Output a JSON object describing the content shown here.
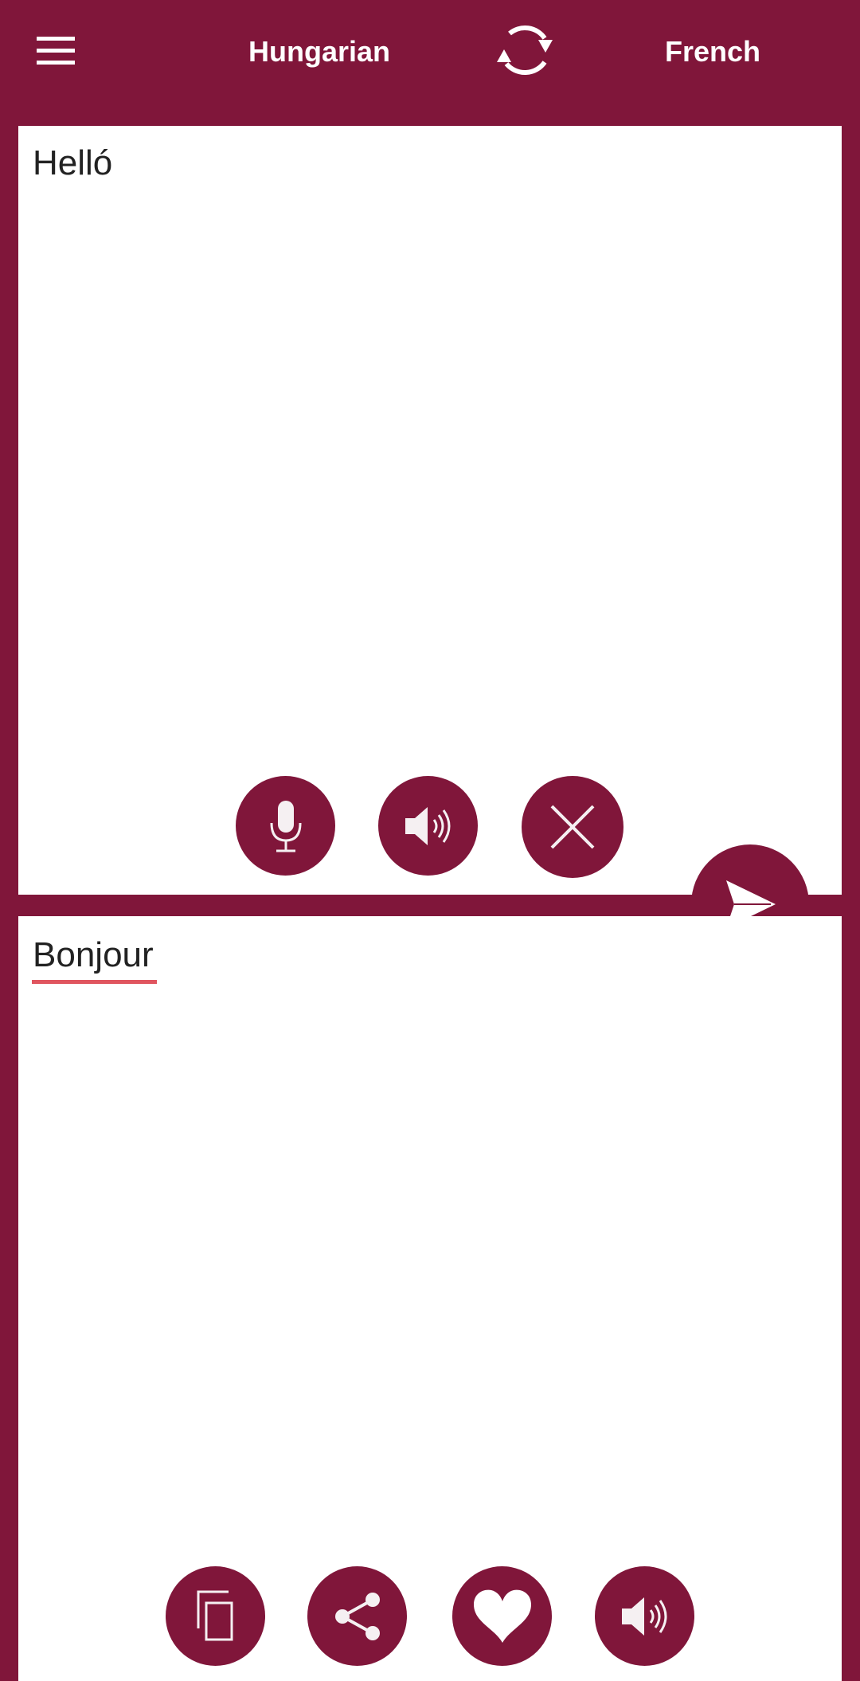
{
  "colors": {
    "brand": "#80163a",
    "panel": "#ffffff",
    "text": "#222222",
    "spellcheck_underline": "#e0555f"
  },
  "header": {
    "menu_icon": "hamburger-menu-icon",
    "source_language": "Hungarian",
    "swap_icon": "swap-languages-icon",
    "target_language": "French"
  },
  "input": {
    "text": "Helló",
    "actions": [
      {
        "name": "microphone",
        "icon": "microphone-icon"
      },
      {
        "name": "speak",
        "icon": "speaker-icon"
      },
      {
        "name": "clear",
        "icon": "close-icon"
      }
    ]
  },
  "translate_button": {
    "icon": "send-icon"
  },
  "output": {
    "text": "Bonjour",
    "actions": [
      {
        "name": "copy",
        "icon": "copy-icon"
      },
      {
        "name": "share",
        "icon": "share-icon"
      },
      {
        "name": "favorite",
        "icon": "heart-icon"
      },
      {
        "name": "speak",
        "icon": "speaker-icon"
      }
    ]
  }
}
